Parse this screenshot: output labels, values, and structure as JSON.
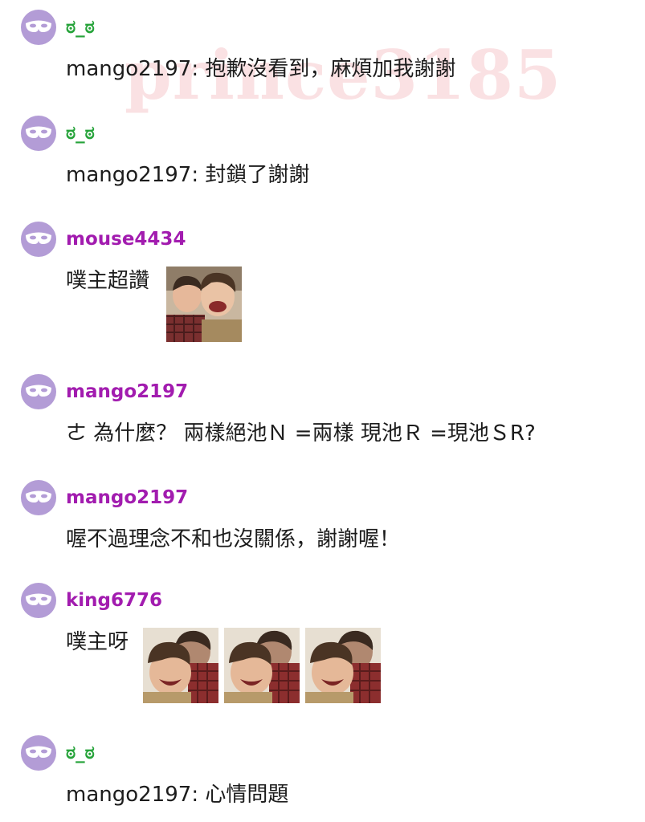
{
  "watermark": "prince3185",
  "colors": {
    "avatar_bg": "#b39cd6",
    "username_green": "#26a33a",
    "username_purple": "#a21caf",
    "watermark": "#e87880"
  },
  "comments": [
    {
      "username": "ಠ_ಠ",
      "text": "mango2197: 抱歉沒看到，麻煩加我謝謝",
      "avatar_icon": "mask-icon"
    },
    {
      "username": "ಠ_ಠ",
      "text": "mango2197: 封鎖了謝謝",
      "avatar_icon": "mask-icon"
    },
    {
      "username": "mouse4434",
      "text": "噗主超讚",
      "avatar_icon": "mask-icon",
      "stickers": [
        "laughing-friends-sticker"
      ]
    },
    {
      "username": "mango2197",
      "text": "ㄜ 為什麼？ 兩樣絕池Ｎ =兩樣 現池Ｒ =現池ＳR?",
      "avatar_icon": "mask-icon"
    },
    {
      "username": "mango2197",
      "text": "喔不過理念不和也沒關係，謝謝喔！",
      "avatar_icon": "mask-icon"
    },
    {
      "username": "king6776",
      "text": "噗主呀",
      "avatar_icon": "mask-icon",
      "stickers": [
        "laughing-man-sticker",
        "laughing-man-sticker",
        "laughing-man-sticker"
      ]
    },
    {
      "username": "ಠ_ಠ",
      "text": "mango2197: 心情問題",
      "avatar_icon": "mask-icon"
    }
  ]
}
